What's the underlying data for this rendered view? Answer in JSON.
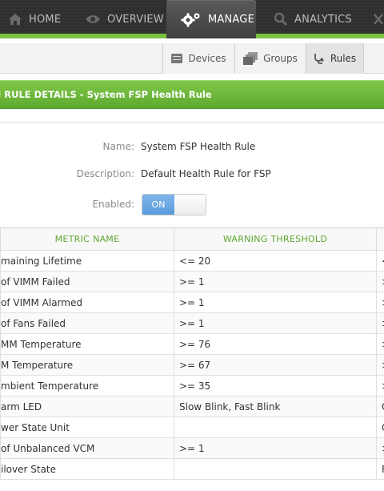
{
  "topnav": {
    "items": [
      {
        "label": "HOME",
        "icon": "home-icon"
      },
      {
        "label": "OVERVIEW",
        "icon": "eye-icon"
      },
      {
        "label": "MANAGE",
        "icon": "gears-icon",
        "active": true
      },
      {
        "label": "ANALYTICS",
        "icon": "search-icon"
      }
    ],
    "colors": {
      "bar": "#333333",
      "accent": "#7ac143"
    }
  },
  "subnav": {
    "tabs": [
      {
        "label": "Devices",
        "icon": "devices-icon"
      },
      {
        "label": "Groups",
        "icon": "groups-icon"
      },
      {
        "label": "Rules",
        "icon": "stethoscope-icon",
        "active": true
      }
    ]
  },
  "panel": {
    "title": "I RULE DETAILS - System FSP Health Rule",
    "title_color": "#6cb63a"
  },
  "form": {
    "name_label": "Name:",
    "name_value": "System FSP Health Rule",
    "description_label": "Description:",
    "description_value": "Default Health Rule for FSP",
    "enabled_label": "Enabled:",
    "enabled_on": "ON",
    "enabled_state": true,
    "toggle_color": "#5a9bdc"
  },
  "table": {
    "headers": [
      "METRIC NAME",
      "WARNING THRESHOLD",
      ""
    ],
    "rows": [
      {
        "metric": "maining Lifetime",
        "warning": "<= 20",
        "critical": "<"
      },
      {
        "metric": "of VIMM Failed",
        "warning": ">= 1",
        "critical": ">"
      },
      {
        "metric": "of VIMM Alarmed",
        "warning": ">= 1",
        "critical": ">"
      },
      {
        "metric": "of Fans Failed",
        "warning": ">= 1",
        "critical": ">"
      },
      {
        "metric": "MM Temperature",
        "warning": ">= 76",
        "critical": ">"
      },
      {
        "metric": "M Temperature",
        "warning": ">= 67",
        "critical": ">"
      },
      {
        "metric": "mbient Temperature",
        "warning": ">= 35",
        "critical": ">"
      },
      {
        "metric": "arm LED",
        "warning": "Slow Blink, Fast Blink",
        "critical": "C"
      },
      {
        "metric": "wer State Unit",
        "warning": "",
        "critical": "C"
      },
      {
        "metric": "of Unbalanced VCM",
        "warning": ">= 1",
        "critical": ">"
      },
      {
        "metric": "ilover State",
        "warning": "",
        "critical": "F"
      }
    ]
  }
}
